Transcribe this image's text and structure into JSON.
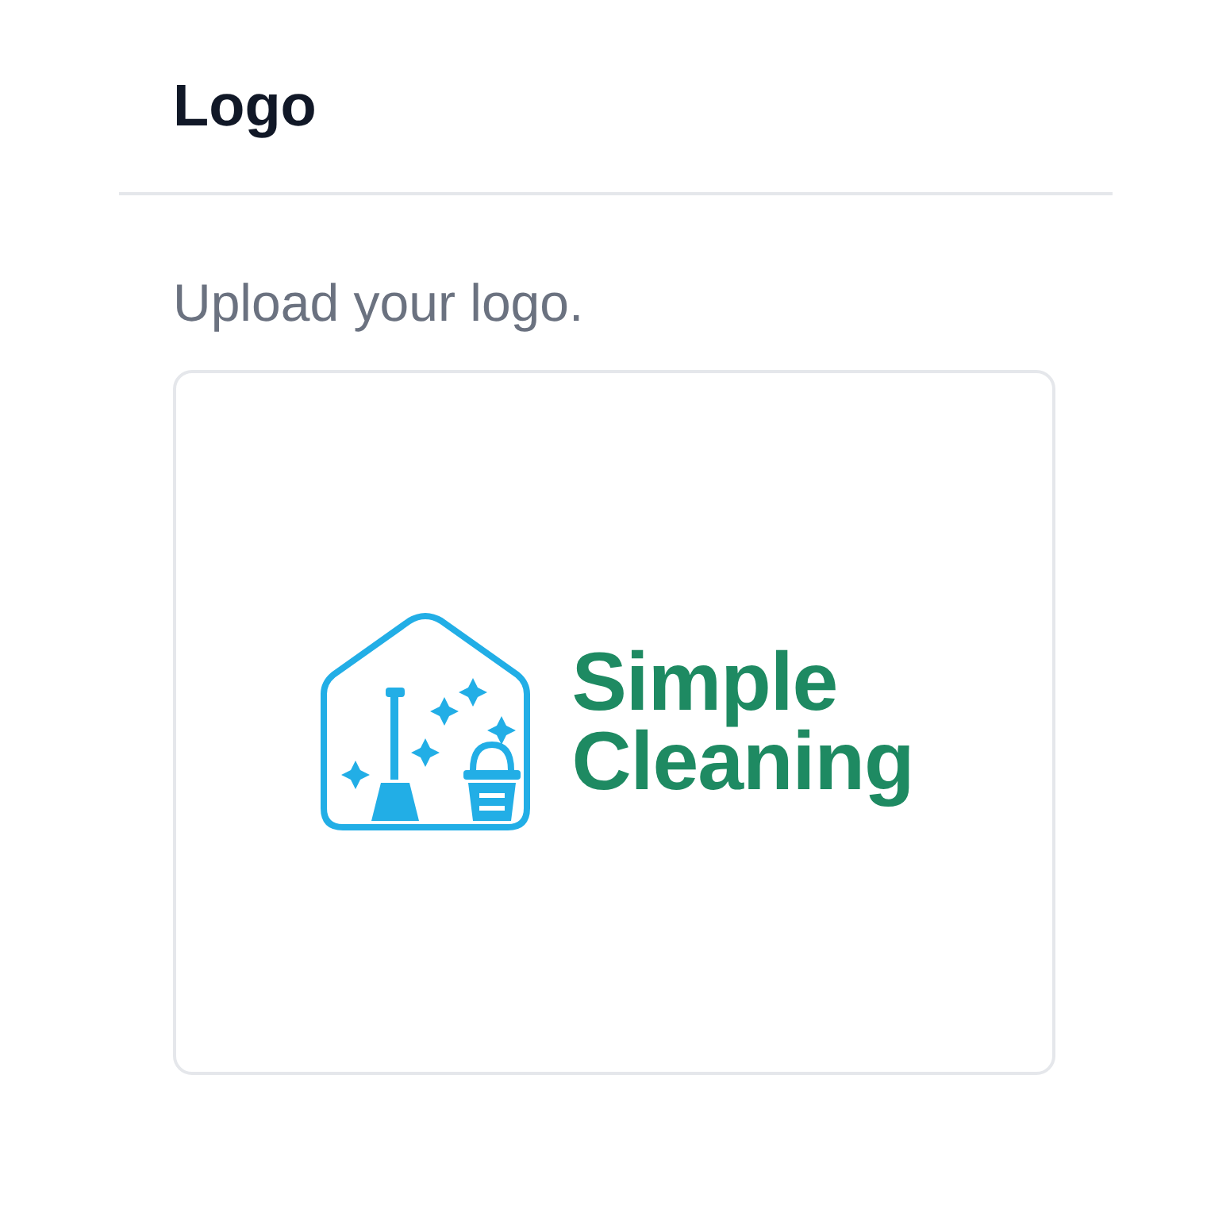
{
  "section": {
    "title": "Logo",
    "instruction": "Upload your logo."
  },
  "logo_preview": {
    "lines": [
      "Simple",
      "Cleaning"
    ]
  }
}
